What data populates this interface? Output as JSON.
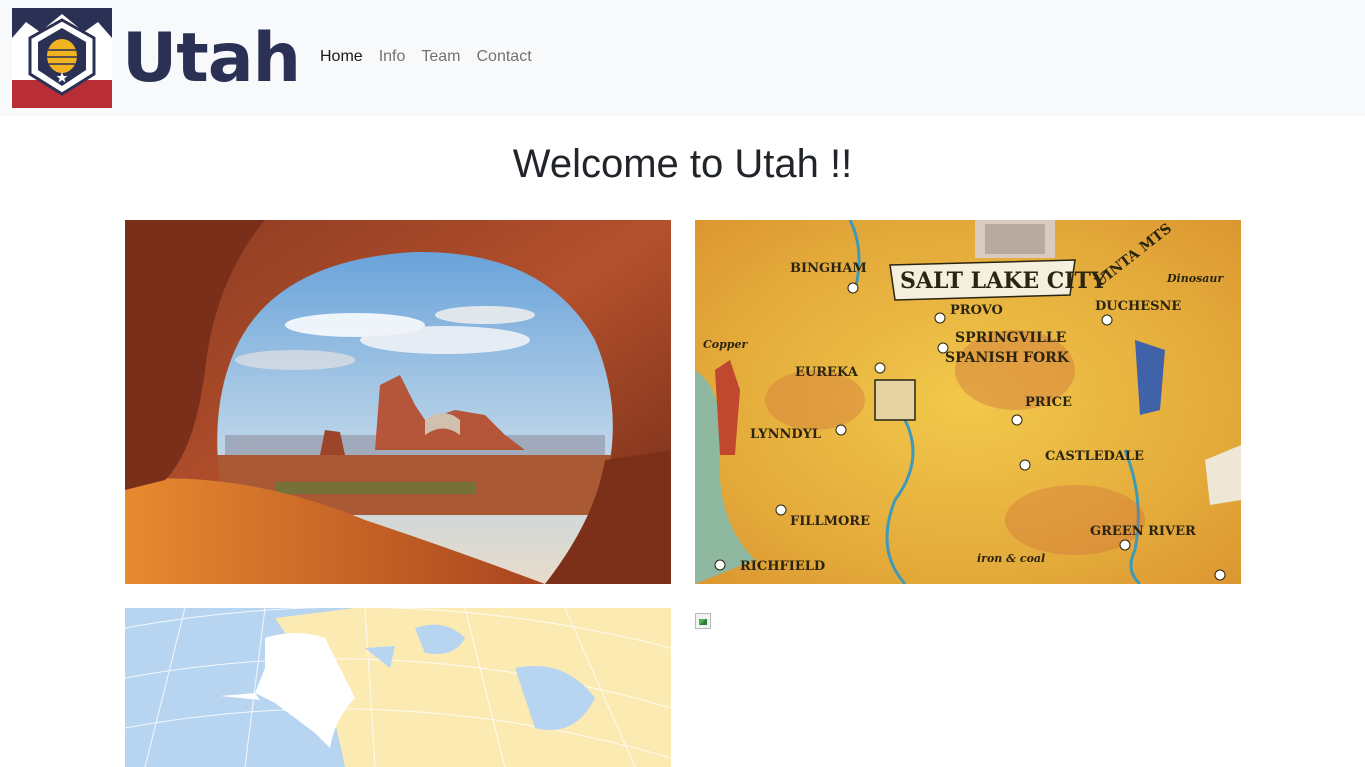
{
  "brand": {
    "name": "Utah"
  },
  "nav": {
    "items": [
      {
        "label": "Home",
        "active": true
      },
      {
        "label": "Info",
        "active": false
      },
      {
        "label": "Team",
        "active": false
      },
      {
        "label": "Contact",
        "active": false
      }
    ]
  },
  "main": {
    "title": "Welcome to Utah !!"
  },
  "map": {
    "labels": [
      "SALT LAKE CITY",
      "BINGHAM",
      "PROVO",
      "SPRINGVILLE",
      "SPANISH FORK",
      "EUREKA",
      "PRICE",
      "LYNNDYL",
      "CASTLEDALE",
      "FILLMORE",
      "GREEN RIVER",
      "RICHFIELD",
      "DUCHESNE",
      "UINTA MTS",
      "Copper",
      "Dinosaur",
      "iron & coal"
    ]
  },
  "colors": {
    "navbar_bg": "#f8f9fa",
    "brand_navy": "#2a3155",
    "brand_red": "#b92d35",
    "link_active": "#000000",
    "link": "#6c6f72"
  }
}
